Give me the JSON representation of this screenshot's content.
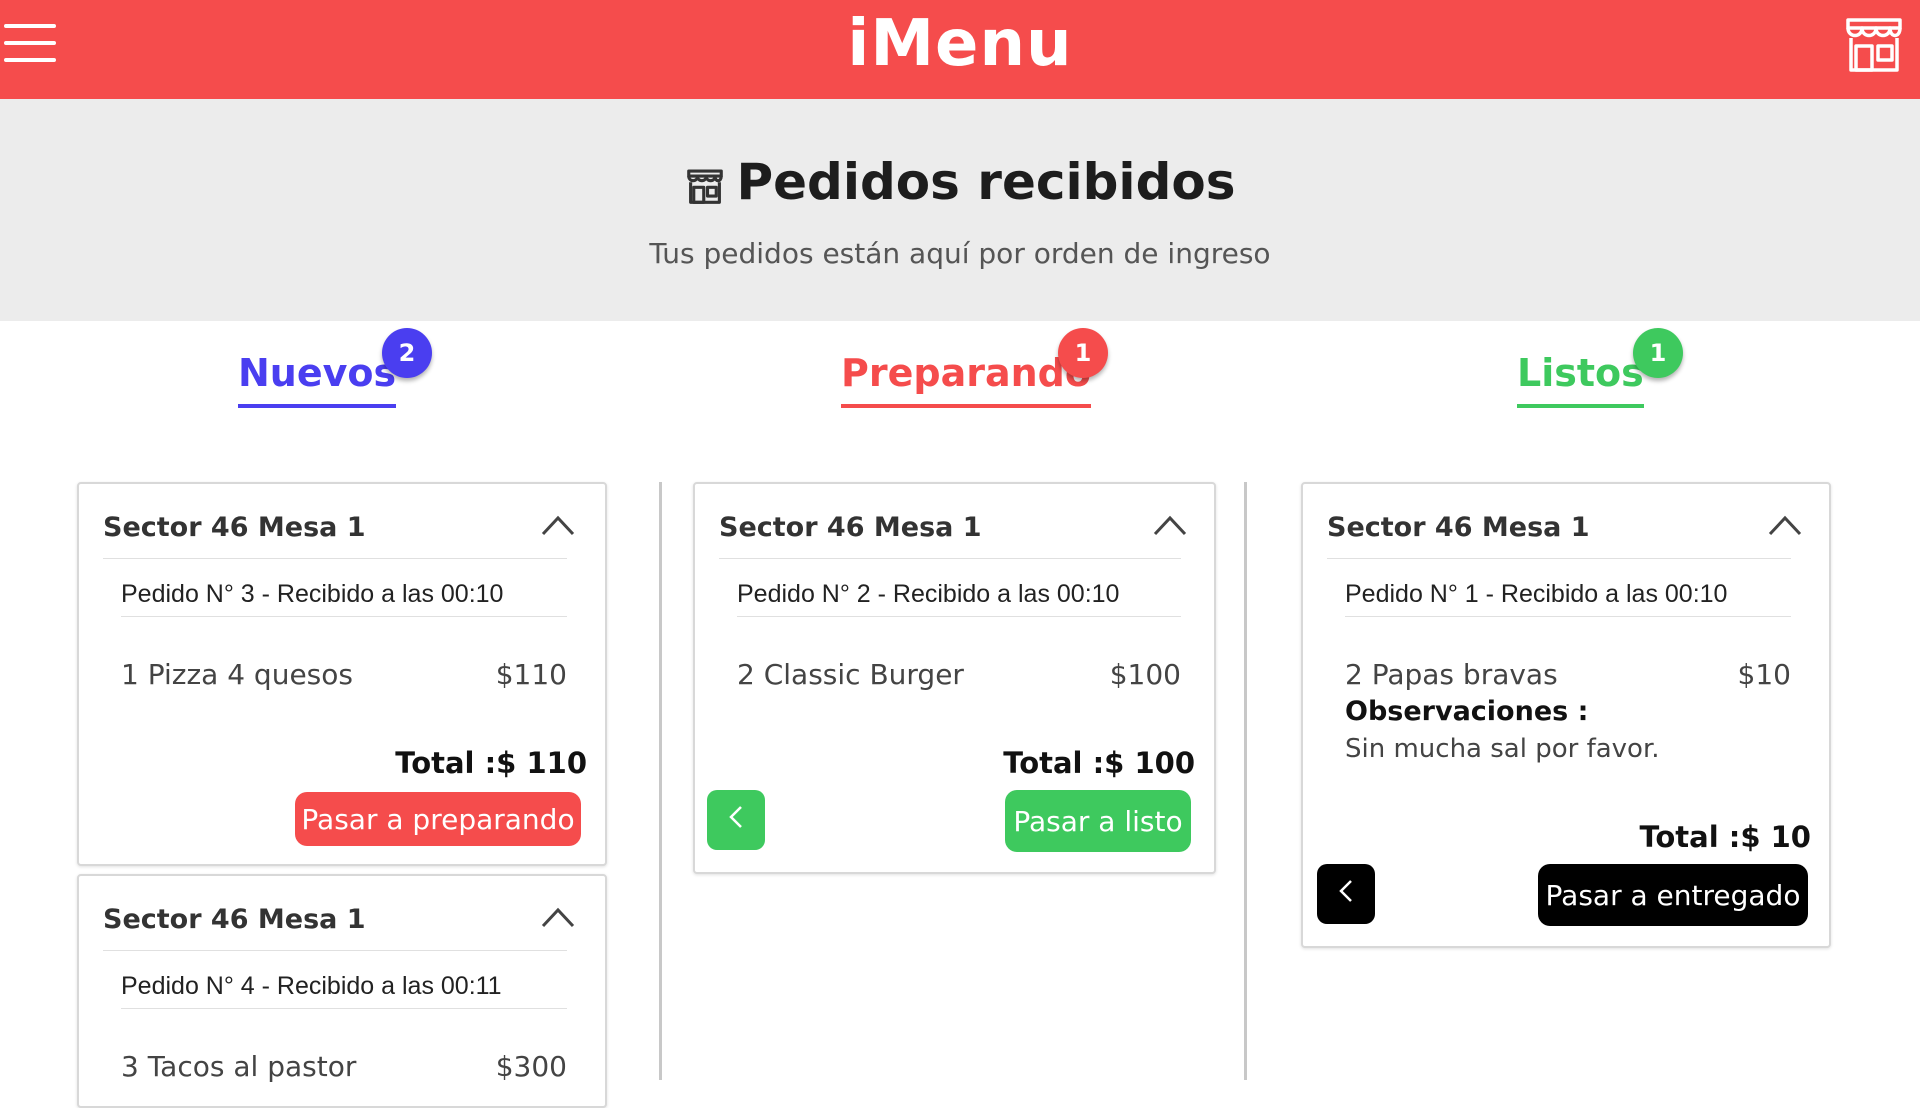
{
  "app": {
    "brand": "iMenu",
    "colors": {
      "topbar": "#f54c4c",
      "nuevos": "#4a3ef0",
      "preparando": "#f54c4c",
      "listos": "#3ec95e",
      "dark": "#000000"
    }
  },
  "header": {
    "title": "Pedidos recibidos",
    "subtitle": "Tus pedidos están aquí por orden de ingreso"
  },
  "tabs": [
    {
      "label": "Nuevos",
      "count": "2"
    },
    {
      "label": "Preparando",
      "count": "1"
    },
    {
      "label": "Listos",
      "count": "1"
    }
  ],
  "columns": {
    "nuevos": {
      "cards": [
        {
          "title": "Sector 46 Mesa 1",
          "order": "Pedido N° 3 - Recibido a las 00:10",
          "item": "1  Pizza 4 quesos",
          "price": "$110",
          "total": "Total :$ 110",
          "action": "Pasar a preparando"
        },
        {
          "title": "Sector 46 Mesa 1",
          "order": "Pedido N° 4 - Recibido a las 00:11",
          "item": "3  Tacos al pastor",
          "price": "$300"
        }
      ]
    },
    "preparando": {
      "cards": [
        {
          "title": "Sector 46 Mesa 1",
          "order": "Pedido N° 2 - Recibido a las 00:10",
          "item": "2  Classic Burger",
          "price": "$100",
          "total": "Total :$ 100",
          "action": "Pasar a listo"
        }
      ]
    },
    "listos": {
      "cards": [
        {
          "title": "Sector 46 Mesa 1",
          "order": "Pedido N° 1 - Recibido a las 00:10",
          "item": "2  Papas bravas",
          "price": "$10",
          "obs_label": "Observaciones :",
          "obs_text": "Sin mucha sal por favor.",
          "total": "Total :$ 10",
          "action": "Pasar a entregado"
        }
      ]
    }
  },
  "icons": [
    "menu-icon",
    "store-icon",
    "chevron-up-icon",
    "chevron-left-icon"
  ]
}
